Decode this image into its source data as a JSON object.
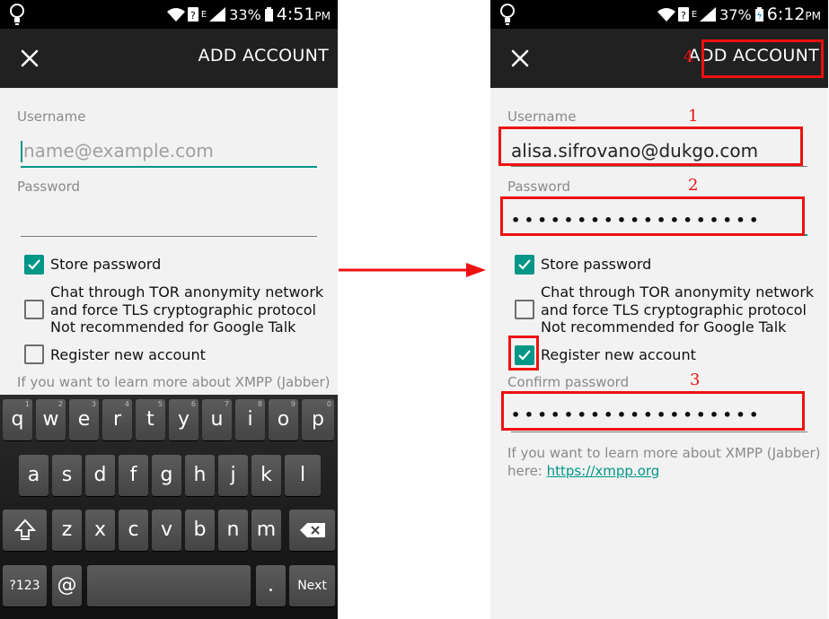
{
  "left": {
    "status": {
      "battery": "33%",
      "time": "4:51",
      "ampm": "PM"
    },
    "appbar": {
      "action": "ADD ACCOUNT"
    },
    "form": {
      "username_label": "Username",
      "username_placeholder": "name@example.com",
      "password_label": "Password",
      "store_password": "Store password",
      "tor_line1": "Chat through TOR anonymity network",
      "tor_line2": "and force TLS cryptographic protocol",
      "tor_line3": "Not recommended for Google Talk",
      "register": "Register new account",
      "note_partial": "If you want to learn more about XMPP (Jabber)"
    },
    "keyboard": {
      "row1": [
        {
          "k": "q",
          "h": "1"
        },
        {
          "k": "w",
          "h": "2"
        },
        {
          "k": "e",
          "h": "3"
        },
        {
          "k": "r",
          "h": "4"
        },
        {
          "k": "t",
          "h": "5"
        },
        {
          "k": "y",
          "h": "6"
        },
        {
          "k": "u",
          "h": "7"
        },
        {
          "k": "i",
          "h": "8"
        },
        {
          "k": "o",
          "h": "9"
        },
        {
          "k": "p",
          "h": "0"
        }
      ],
      "row2": [
        "a",
        "s",
        "d",
        "f",
        "g",
        "h",
        "j",
        "k",
        "l"
      ],
      "row3": [
        "z",
        "x",
        "c",
        "v",
        "b",
        "n",
        "m"
      ],
      "sym": "?123",
      "at": "@",
      "period": ".",
      "next": "Next"
    }
  },
  "right": {
    "status": {
      "battery": "37%",
      "time": "6:12",
      "ampm": "PM"
    },
    "appbar": {
      "action": "ADD ACCOUNT"
    },
    "form": {
      "username_label": "Username",
      "username_value": "alisa.sifrovano@dukgo.com",
      "password_label": "Password",
      "password_value": "•••••••••••••••••••",
      "store_password": "Store password",
      "tor_line1": "Chat through TOR anonymity network",
      "tor_line2": "and force TLS cryptographic protocol",
      "tor_line3": "Not recommended for Google Talk",
      "register": "Register new account",
      "confirm_label": "Confirm password",
      "confirm_value": "•••••••••••••••••••",
      "note_line1": "If you want to learn more about XMPP (Jabber)",
      "note_here": "here: ",
      "note_link": "https://xmpp.org"
    },
    "annotations": {
      "n1": "1",
      "n2": "2",
      "n3": "3",
      "n4": "4"
    }
  },
  "colors": {
    "accent": "#009688",
    "annotation": "#ee1111",
    "appbar": "#212121"
  }
}
